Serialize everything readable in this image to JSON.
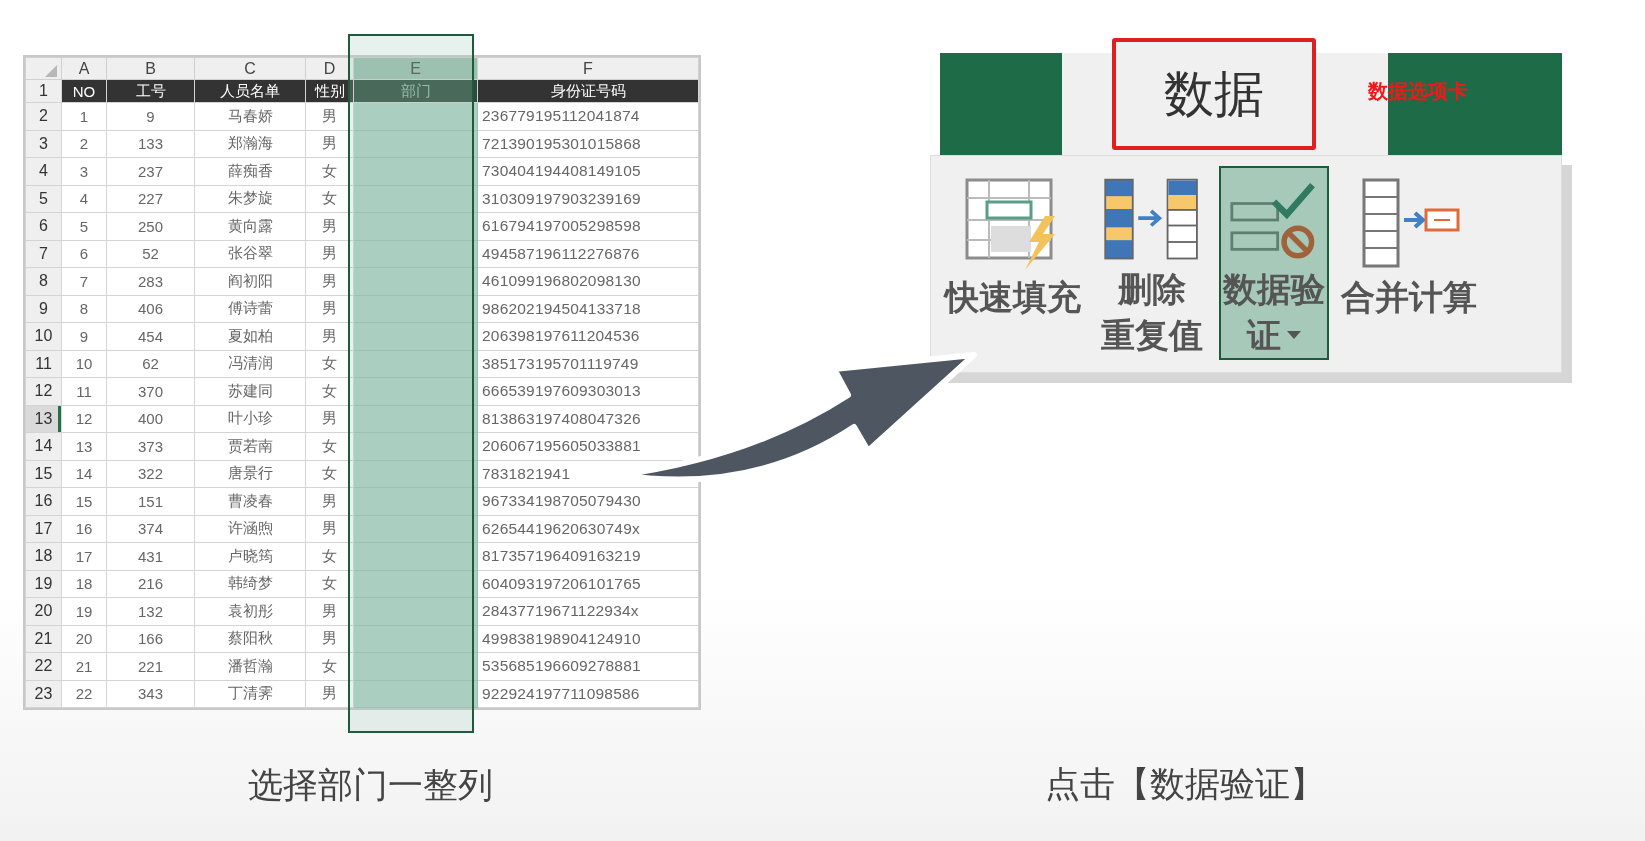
{
  "spreadsheet": {
    "columns": [
      {
        "letter": "A",
        "header": "NO",
        "selected": false
      },
      {
        "letter": "B",
        "header": "工号",
        "selected": false
      },
      {
        "letter": "C",
        "header": "人员名单",
        "selected": false
      },
      {
        "letter": "D",
        "header": "性别",
        "selected": false
      },
      {
        "letter": "E",
        "header": "部门",
        "selected": true
      },
      {
        "letter": "F",
        "header": "身份证号码",
        "selected": false
      }
    ],
    "header_row_number": "1",
    "rows": [
      {
        "number": "2",
        "no": "1",
        "job_no": "9",
        "name": "马春娇",
        "gender": "男",
        "id_number": "236779195112041874",
        "active": false
      },
      {
        "number": "3",
        "no": "2",
        "job_no": "133",
        "name": "郑瀚海",
        "gender": "男",
        "id_number": "721390195301015868",
        "active": false
      },
      {
        "number": "4",
        "no": "3",
        "job_no": "237",
        "name": "薛痴香",
        "gender": "女",
        "id_number": "730404194408149105",
        "active": false
      },
      {
        "number": "5",
        "no": "4",
        "job_no": "227",
        "name": "朱梦旋",
        "gender": "女",
        "id_number": "310309197903239169",
        "active": false
      },
      {
        "number": "6",
        "no": "5",
        "job_no": "250",
        "name": "黄向露",
        "gender": "男",
        "id_number": "616794197005298598",
        "active": false
      },
      {
        "number": "7",
        "no": "6",
        "job_no": "52",
        "name": "张谷翠",
        "gender": "男",
        "id_number": "494587196112276876",
        "active": false
      },
      {
        "number": "8",
        "no": "7",
        "job_no": "283",
        "name": "阎初阳",
        "gender": "男",
        "id_number": "461099196802098130",
        "active": false
      },
      {
        "number": "9",
        "no": "8",
        "job_no": "406",
        "name": "傅诗蕾",
        "gender": "男",
        "id_number": "986202194504133718",
        "active": false
      },
      {
        "number": "10",
        "no": "9",
        "job_no": "454",
        "name": "夏如柏",
        "gender": "男",
        "id_number": "206398197611204536",
        "active": false
      },
      {
        "number": "11",
        "no": "10",
        "job_no": "62",
        "name": "冯清润",
        "gender": "女",
        "id_number": "385173195701119749",
        "active": false
      },
      {
        "number": "12",
        "no": "11",
        "job_no": "370",
        "name": "苏建同",
        "gender": "女",
        "id_number": "666539197609303013",
        "active": false
      },
      {
        "number": "13",
        "no": "12",
        "job_no": "400",
        "name": "叶小珍",
        "gender": "男",
        "id_number": "813863197408047326",
        "active": true
      },
      {
        "number": "14",
        "no": "13",
        "job_no": "373",
        "name": "贾若南",
        "gender": "女",
        "id_number": "206067195605033881",
        "active": false
      },
      {
        "number": "15",
        "no": "14",
        "job_no": "322",
        "name": "唐景行",
        "gender": "女",
        "id_number": "7831821941",
        "active": false
      },
      {
        "number": "16",
        "no": "15",
        "job_no": "151",
        "name": "曹凌春",
        "gender": "男",
        "id_number": "967334198705079430",
        "active": false
      },
      {
        "number": "17",
        "no": "16",
        "job_no": "374",
        "name": "许涵煦",
        "gender": "男",
        "id_number": "62654419620630749x",
        "active": false
      },
      {
        "number": "18",
        "no": "17",
        "job_no": "431",
        "name": "卢晓筠",
        "gender": "女",
        "id_number": "817357196409163219",
        "active": false
      },
      {
        "number": "19",
        "no": "18",
        "job_no": "216",
        "name": "韩绮梦",
        "gender": "女",
        "id_number": "604093197206101765",
        "active": false
      },
      {
        "number": "20",
        "no": "19",
        "job_no": "132",
        "name": "袁初彤",
        "gender": "男",
        "id_number": "28437719671122934x",
        "active": false
      },
      {
        "number": "21",
        "no": "20",
        "job_no": "166",
        "name": "蔡阳秋",
        "gender": "男",
        "id_number": "499838198904124910",
        "active": false
      },
      {
        "number": "22",
        "no": "21",
        "job_no": "221",
        "name": "潘哲瀚",
        "gender": "女",
        "id_number": "535685196609278881",
        "active": false
      },
      {
        "number": "23",
        "no": "22",
        "job_no": "343",
        "name": "丁清霁",
        "gender": "男",
        "id_number": "922924197711098586",
        "active": false
      }
    ]
  },
  "ribbon": {
    "tab": {
      "label": "数据",
      "highlighted": true
    },
    "annotation": "数据选项卡",
    "buttons": [
      {
        "kind": "flash_fill",
        "lines": [
          "快速填充"
        ],
        "selected": false,
        "dropdown": false
      },
      {
        "kind": "remove_duplicates",
        "lines": [
          "删除",
          "重复值"
        ],
        "selected": false,
        "dropdown": false
      },
      {
        "kind": "data_validation",
        "lines": [
          "数据验",
          "证"
        ],
        "selected": true,
        "dropdown": true
      },
      {
        "kind": "consolidate",
        "lines": [
          "合并计算"
        ],
        "selected": false,
        "dropdown": false
      }
    ]
  },
  "captions": [
    "选择部门一整列",
    "点击【数据验证】"
  ]
}
